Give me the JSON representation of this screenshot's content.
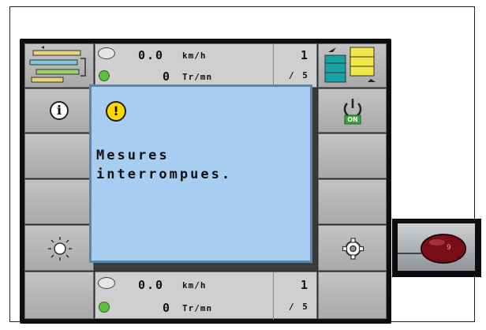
{
  "top_status": {
    "speed_value": "0.0",
    "speed_unit": "km/h",
    "rpm_value": "0",
    "rpm_unit": "Tr/mn",
    "count_value": "1",
    "count_sub": "/ 5"
  },
  "bottom_status": {
    "speed_value": "0.0",
    "speed_unit": "km/h",
    "rpm_value": "0",
    "rpm_unit": "Tr/mn",
    "count_value": "1",
    "count_sub": "/ 5"
  },
  "dialog": {
    "message_line1": "Mesures",
    "message_line2": "interrompues."
  },
  "power_badge": "ON",
  "knob_number": "9",
  "colors": {
    "dialog_bg": "#a7cdf0",
    "dialog_border": "#5b86ad",
    "warning": "#ffd800",
    "panel_bg": "#cfcfcf"
  }
}
